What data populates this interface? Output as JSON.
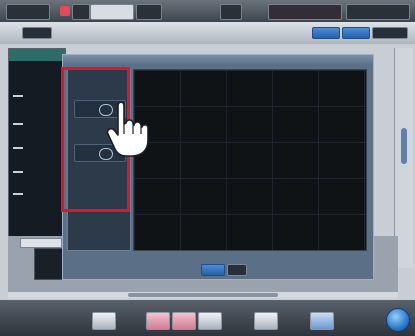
{
  "topbar": {
    "tabs": [
      {
        "label": "",
        "active": true
      },
      {
        "label": "",
        "active": false
      }
    ]
  },
  "modal": {
    "title": "",
    "side_labels": [
      "",
      "",
      "",
      ""
    ],
    "footer_ok": "",
    "footer_cancel": ""
  },
  "colors": {
    "highlight": "#e0142c",
    "accent_blue": "#2660a7"
  },
  "icons": {
    "cursor": "hand-pointer-icon"
  }
}
